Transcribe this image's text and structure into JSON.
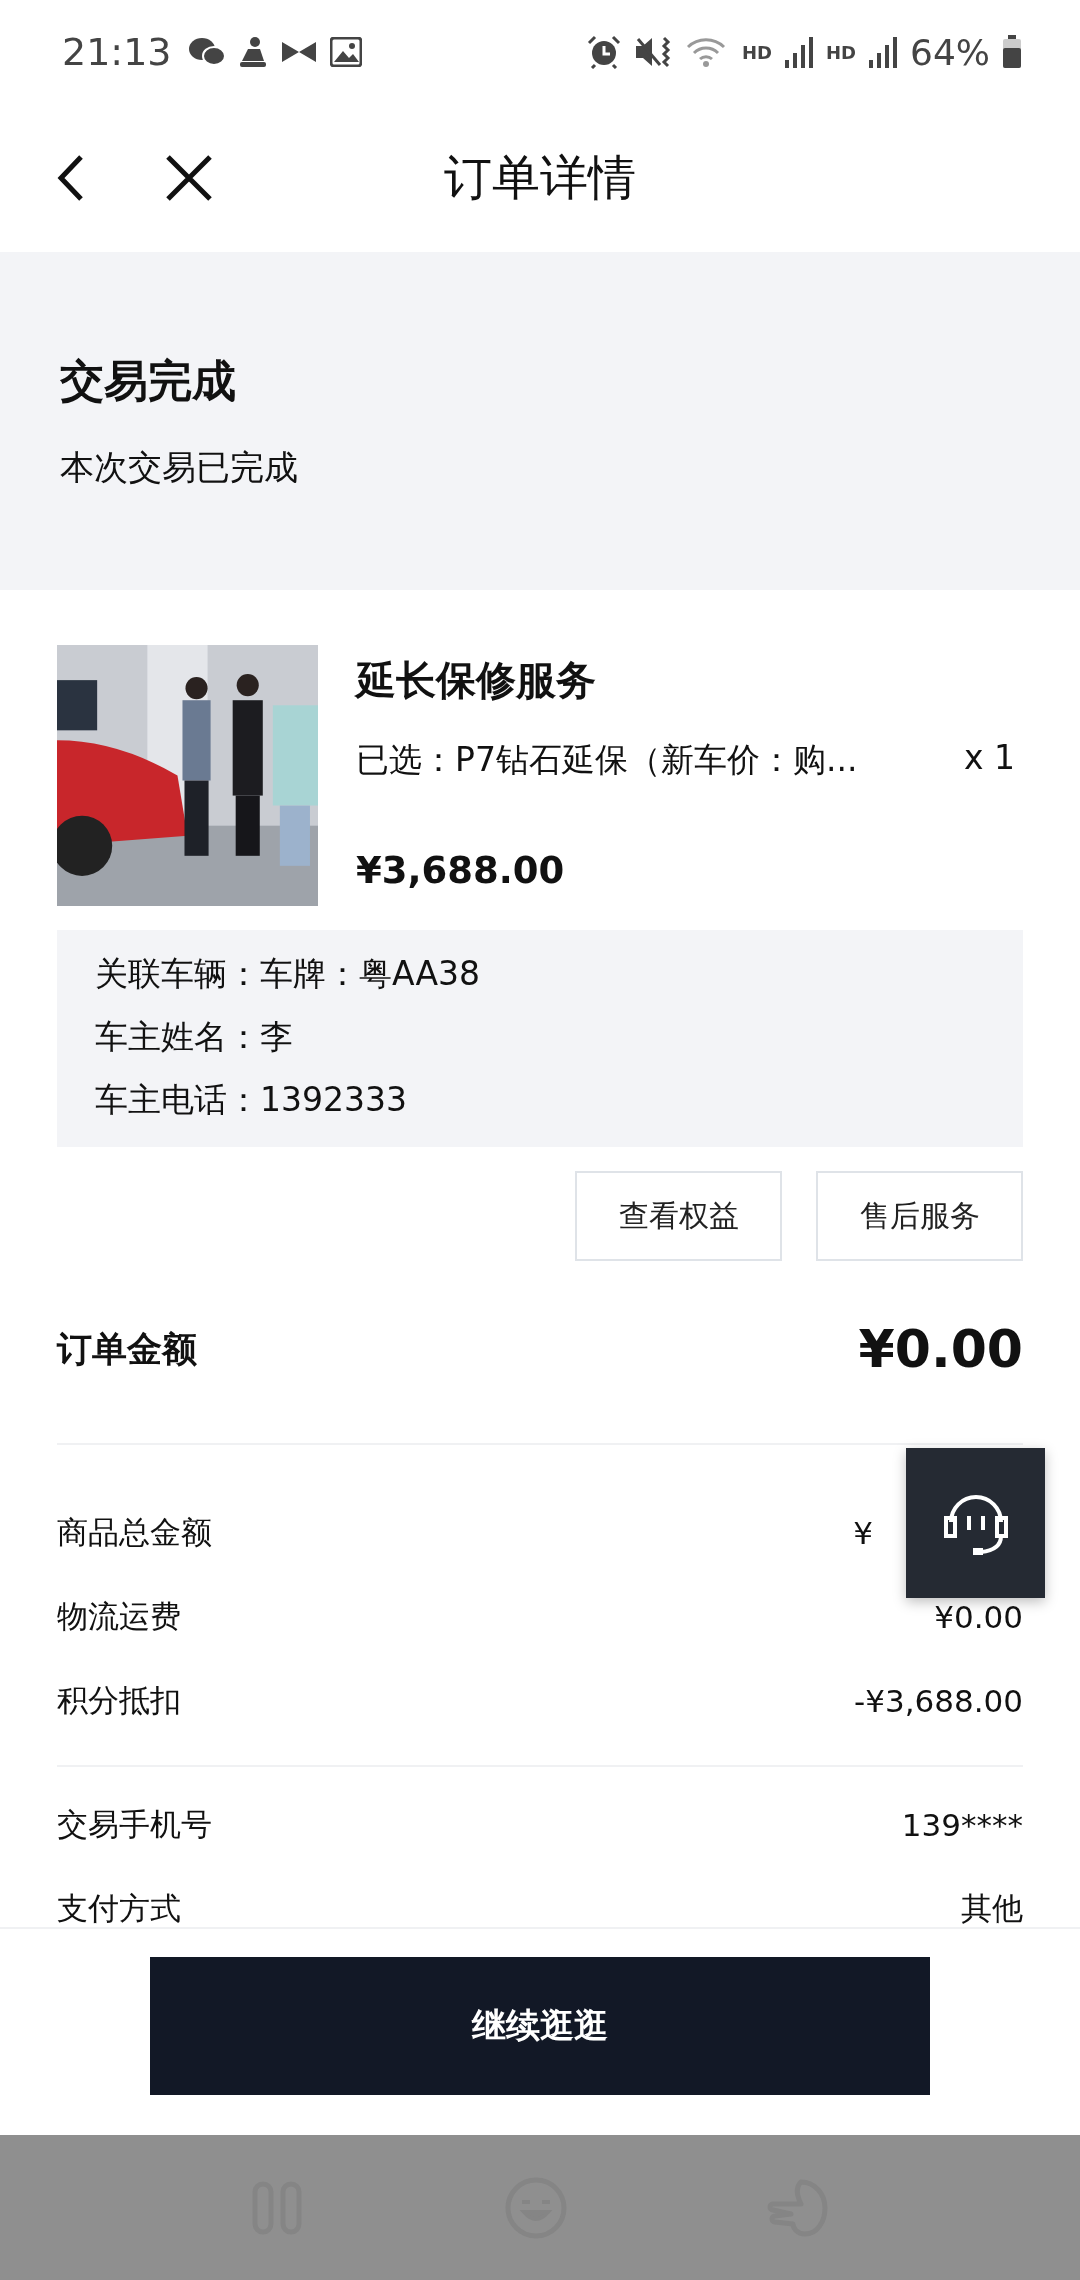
{
  "status_bar": {
    "time": "21:13",
    "network": [
      "HD",
      "HD"
    ],
    "battery": "64%"
  },
  "header": {
    "title": "订单详情"
  },
  "order_status": {
    "title": "交易完成",
    "message": "本次交易已完成"
  },
  "product": {
    "name": "延长保修服务",
    "spec": "已选：P7钻石延保（新车价：购...",
    "quantity": "x 1",
    "price": "¥3,688.00"
  },
  "vehicle_info": [
    "关联车辆：车牌：粤AA38",
    "车主姓名：李",
    "车主电话：1392333"
  ],
  "actions": [
    "查看权益",
    "售后服务"
  ],
  "order_total": {
    "label": "订单金额",
    "value": "¥0.00"
  },
  "breakdown": [
    {
      "label": "商品总金额",
      "value": "¥",
      "partly_hidden": true
    },
    {
      "label": "物流运费",
      "value": "¥0.00"
    },
    {
      "label": "积分抵扣",
      "value": "-¥3,688.00"
    }
  ],
  "payment_details": [
    {
      "label": "交易手机号",
      "value": "139****"
    },
    {
      "label": "支付方式",
      "value": "其他"
    }
  ],
  "primary_button": "继续逛逛"
}
